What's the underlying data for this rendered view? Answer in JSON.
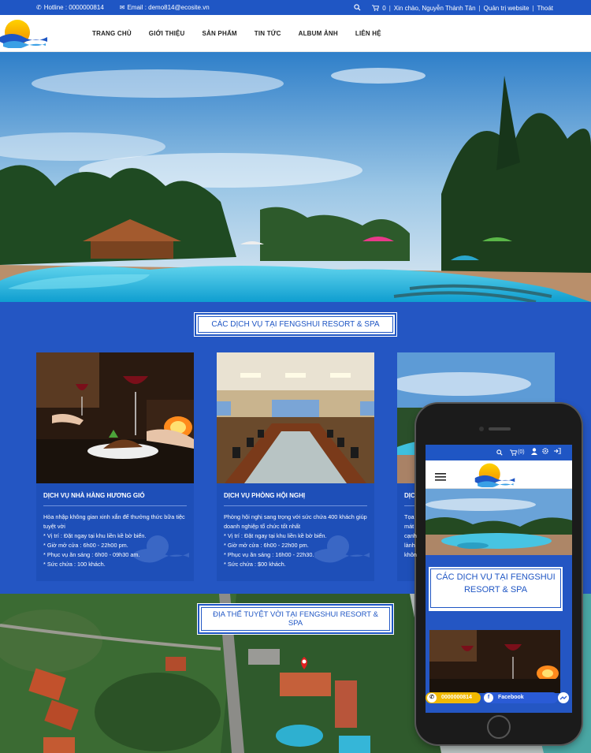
{
  "topbar": {
    "hotline": "Hotline : 0000000814",
    "email": "Email : demo814@ecosite.vn",
    "cart_count": "0",
    "greeting": "Xin chào, Nguyễn Thành Tân",
    "admin_link": "Quản trị website",
    "logout_link": "Thoát"
  },
  "nav": {
    "items": [
      "TRANG CHỦ",
      "GIỚI THIỆU",
      "SẢN PHẨM",
      "TIN TỨC",
      "ALBUM ẢNH",
      "LIÊN HỆ"
    ]
  },
  "services": {
    "title": "CÁC DỊCH VỤ TẠI FENGSHUI RESORT & SPA",
    "cards": [
      {
        "title": "DỊCH VỤ NHÀ HÀNG HƯƠNG GIÓ",
        "desc": "Hòa nhập không gian xinh xắn để thưởng thức bữa tiệc tuyệt vời\n* Vị trí : Đặt ngay tại khu liền kề bờ biển.\n* Giờ mở cửa : 6h00 - 22h00 pm.\n* Phục vụ ăn sáng : 6h00 - 09h30 am.\n* Sức chứa : 100 khách."
      },
      {
        "title": "DỊCH VỤ PHÒNG HỘI NGHỊ",
        "desc": "Phòng hội nghị sang trọng với sức chứa 400 khách giúp doanh nghiệp tổ chức tốt nhất\n* Vị trí : Đặt ngay tại khu liền kề bờ biển.\n* Giờ mở cửa : 6h00 - 22h00 pm.\n* Phục vụ ăn sáng : 16h00 - 22h30.\n* Sức chứa : $00 khách."
      },
      {
        "title": "DỊC",
        "desc": "Tọa\nmát\ncạnh\nlành\nkhôn"
      }
    ]
  },
  "map_section": {
    "title": "ĐỊA THẾ TUYỆT VỜI TẠI FENGSHUI RESORT & SPA"
  },
  "phone": {
    "cart": "(0)",
    "title": "CÁC DỊCH VỤ TẠI FENGSHUI RESORT & SPA",
    "hotline": "0000000814",
    "facebook": "Facebook"
  },
  "colors": {
    "brand_blue": "#1f56c4",
    "section_blue": "#2456c3",
    "hotline_yellow": "#f0b800"
  }
}
